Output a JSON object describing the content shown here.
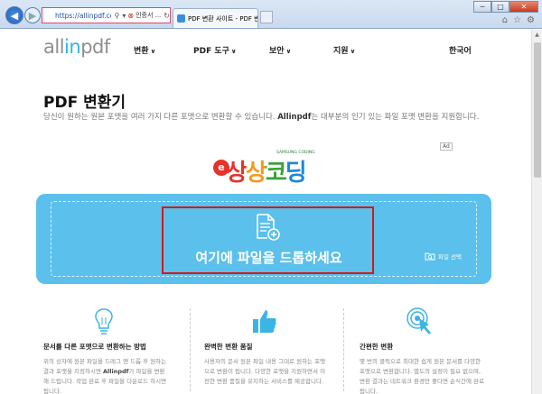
{
  "browser": {
    "url": "https://allinpdf.com/conv",
    "cert_label": "인증서 ...",
    "tab_title": "PDF 변환 사이트 - PDF 변...",
    "window_buttons": [
      "─",
      "□",
      "✕"
    ]
  },
  "header": {
    "logo_left": "all",
    "logo_mid": "in",
    "logo_right": "pdf",
    "nav": [
      {
        "label": "변환"
      },
      {
        "label": "PDF 도구"
      },
      {
        "label": "보안"
      },
      {
        "label": "지원"
      }
    ],
    "language": "한국어"
  },
  "main": {
    "title": "PDF 변환기",
    "desc_before": "당신이 원하는 원본 포맷을 여러 가지 다른 포맷으로 변환할 수 있습니다. ",
    "desc_brand": "Allinpdf",
    "desc_after": "는 대부분의 인기 있는 파일 포맷 변환을 지원합니다.",
    "ad_badge": "Ad",
    "ad_text": "상상코딩",
    "ad_sub": "SAMSUNG CODING",
    "ad_e": "e",
    "drop_text": "여기에 파일을 드롭하세요",
    "file_select": "파일 선택"
  },
  "features": [
    {
      "title": "문서를 다른 포맷으로 변환하는 방법",
      "text_a": "위의 상자에 원본 파일을 드래그 앤 드롭 후 원하는 결과 포맷을 지정하시면 ",
      "brand": "Allinpdf",
      "text_b": "가 파일을 변환해 드립니다. 작업 완료 후 파일을 다운로드 하시면 됩니다."
    },
    {
      "title": "완벽한 변환 품질",
      "text": "사용자의 문서 원본 파일 내용 그대로 원하는 포맷으로 변환이 됩니다. 다양한 포맷을 지원하면서 이전한 변환 품질을 유지하는 서비스를 제공합니다."
    },
    {
      "title": "간편한 변환",
      "text": "몇 번의 클릭으로 최대한 쉽게 원본 문서를 다양한 포맷으로 변환합니다. 별도의 설정이 필요 없으며, 변환 결과는 네트워크 환경만 좋다면 순식간에 완료됩니다."
    }
  ],
  "colors": {
    "accent": "#5bc0eb",
    "logo_accent": "#2db6e8",
    "highlight_box": "#d41818"
  }
}
